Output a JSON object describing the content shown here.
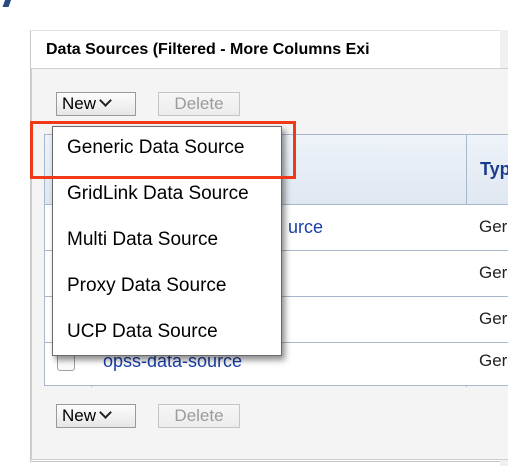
{
  "panel": {
    "title": "Data Sources (Filtered - More Columns Exi"
  },
  "toolbar_top": {
    "new_label": "New",
    "delete_label": "Delete"
  },
  "toolbar_bottom": {
    "new_label": "New",
    "delete_label": "Delete"
  },
  "table": {
    "type_header": "Typ",
    "rows": [
      {
        "name": "urce",
        "type": "Ger"
      },
      {
        "name": "",
        "type": "Ger"
      },
      {
        "name": "",
        "type": "Ger"
      },
      {
        "name": "opss-data-source",
        "type": "Ger"
      }
    ]
  },
  "menu": {
    "items": [
      "Generic Data Source",
      "GridLink Data Source",
      "Multi Data Source",
      "Proxy Data Source",
      "UCP Data Source"
    ]
  },
  "colors": {
    "highlight": "#f03a17",
    "link": "#1a3fa8",
    "header_text": "#1a3c8c"
  }
}
